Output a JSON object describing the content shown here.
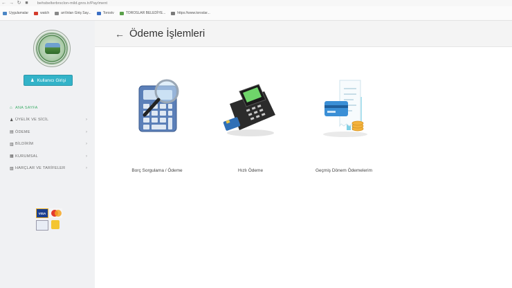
{
  "browser": {
    "url": "behsbelterbrsclon-mild.gnrs.tr/Pay/ment"
  },
  "bookmarks": [
    {
      "label": "Uygulamalar",
      "color": "#4a86c5"
    },
    {
      "label": "watch",
      "color": "#d33b2c"
    },
    {
      "label": "anVolan Giriş Say...",
      "color": "#888888"
    },
    {
      "label": "Torostv",
      "color": "#3b6fc4"
    },
    {
      "label": "TOROSLAR BELEDİYE...",
      "color": "#5aa04a"
    },
    {
      "label": "https://www.toroslar...",
      "color": "#7a7a7a"
    }
  ],
  "sidebar": {
    "login_label": "Kullanıcı Girişi",
    "menu": [
      {
        "label": "ANA SAYFA",
        "icon": "home-icon",
        "glyph": "⌂",
        "has_chevron": false,
        "active": true
      },
      {
        "label": "ÜYELİK VE SİCİL",
        "icon": "user-icon",
        "glyph": "♟",
        "has_chevron": true,
        "active": false
      },
      {
        "label": "ÖDEME",
        "icon": "card-icon",
        "glyph": "▤",
        "has_chevron": true,
        "active": false
      },
      {
        "label": "BİLDİRİM",
        "icon": "file-icon",
        "glyph": "▥",
        "has_chevron": true,
        "active": false
      },
      {
        "label": "KURUMSAL",
        "icon": "building-icon",
        "glyph": "▦",
        "has_chevron": true,
        "active": false
      },
      {
        "label": "HARÇLAR VE TARİFELER",
        "icon": "document-icon",
        "glyph": "▧",
        "has_chevron": true,
        "active": false
      }
    ],
    "card_logo_text": "VISA"
  },
  "header": {
    "back_glyph": "←",
    "title": "Ödeme İşlemleri"
  },
  "tiles": [
    {
      "label": "Borç Sorgulama / Ödeme",
      "icon": "calculator-magnifier-icon"
    },
    {
      "label": "Hızlı Ödeme",
      "icon": "pos-terminal-icon"
    },
    {
      "label": "Geçmiş Dönem Ödemelerim",
      "icon": "receipt-history-icon"
    }
  ]
}
